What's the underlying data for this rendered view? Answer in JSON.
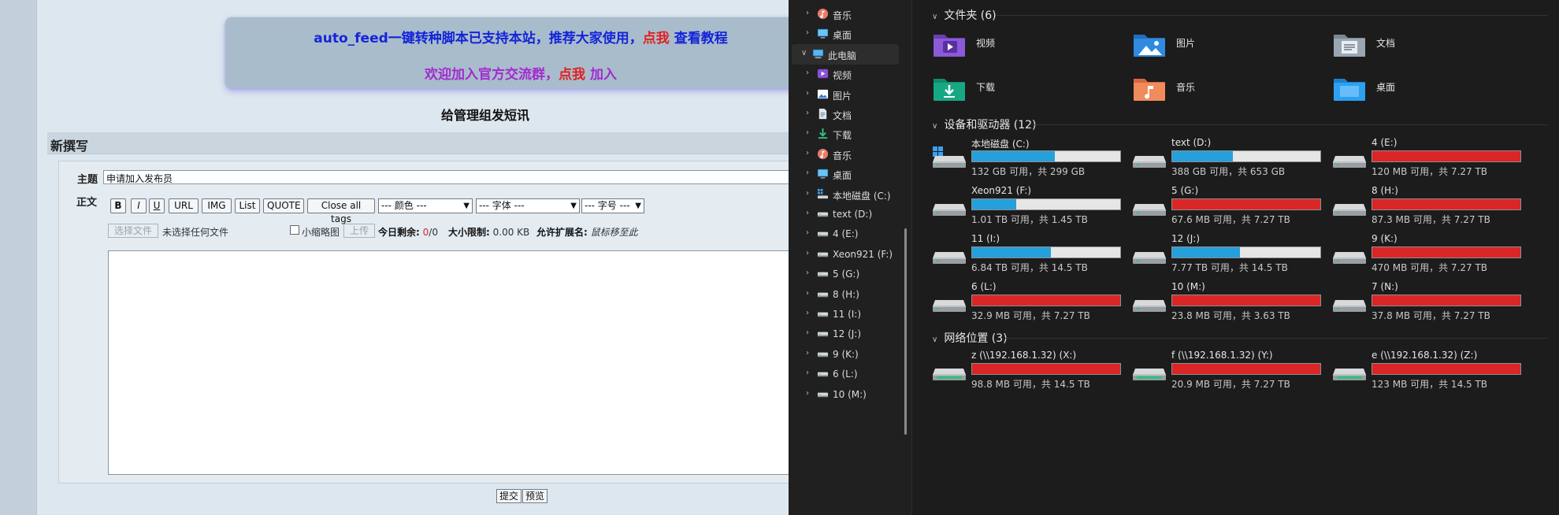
{
  "web": {
    "notice_line1_a": "auto_feed一键转种脚本已支持本站，推荐大家使用，",
    "notice_line1_red": "点我",
    "notice_line1_b": " 查看教程",
    "notice_line2_a": "欢迎加入官方交流群，",
    "notice_line2_red": "点我",
    "notice_line2_b": " 加入",
    "pm_title": "给管理组发短讯",
    "compose_title": "新撰写",
    "subject_label": "主题",
    "subject_value": "申请加入发布员",
    "body_label": "正文",
    "toolbar": [
      "B",
      "I",
      "U",
      "URL",
      "IMG",
      "List",
      "QUOTE",
      "Close all tags"
    ],
    "color_select": "--- 颜色 ---",
    "font_select": "--- 字体 ---",
    "size_select": "--- 字号 ---",
    "choose_file": "选择文件",
    "no_file": "未选择任何文件",
    "thumb_label": "小缩略图",
    "upload": "上传",
    "remaining_label": "今日剩余:",
    "remaining_used": "0",
    "remaining_total": "/0",
    "size_limit_label": "大小限制:",
    "size_limit_value": "0.00 KB",
    "ext_label": "允许扩展名:",
    "ext_value": "鼠标移至此",
    "submit": "提交",
    "preview": "预览"
  },
  "explorer": {
    "nav": [
      {
        "label": "音乐",
        "icon": "music-icon",
        "indent": 1
      },
      {
        "label": "桌面",
        "icon": "desktop-icon",
        "indent": 1
      },
      {
        "label": "此电脑",
        "icon": "computer-icon",
        "indent": 0,
        "expanded": true
      },
      {
        "label": "视频",
        "icon": "video-icon",
        "indent": 1
      },
      {
        "label": "图片",
        "icon": "pictures-icon",
        "indent": 1
      },
      {
        "label": "文档",
        "icon": "documents-icon",
        "indent": 1
      },
      {
        "label": "下载",
        "icon": "download-icon",
        "indent": 1
      },
      {
        "label": "音乐",
        "icon": "music-icon",
        "indent": 1
      },
      {
        "label": "桌面",
        "icon": "desktop-icon",
        "indent": 1
      },
      {
        "label": "本地磁盘 (C:)",
        "icon": "system-drive-icon",
        "indent": 1
      },
      {
        "label": "text (D:)",
        "icon": "drive-icon",
        "indent": 1
      },
      {
        "label": "4 (E:)",
        "icon": "drive-icon",
        "indent": 1
      },
      {
        "label": "Xeon921 (F:)",
        "icon": "drive-icon",
        "indent": 1
      },
      {
        "label": "5 (G:)",
        "icon": "drive-icon",
        "indent": 1
      },
      {
        "label": "8 (H:)",
        "icon": "drive-icon",
        "indent": 1
      },
      {
        "label": "11 (I:)",
        "icon": "drive-icon",
        "indent": 1
      },
      {
        "label": "12 (J:)",
        "icon": "drive-icon",
        "indent": 1
      },
      {
        "label": "9 (K:)",
        "icon": "drive-icon",
        "indent": 1
      },
      {
        "label": "6 (L:)",
        "icon": "drive-icon",
        "indent": 1
      },
      {
        "label": "10 (M:)",
        "icon": "drive-icon",
        "indent": 1
      }
    ],
    "folders_header": "文件夹 (6)",
    "folders": [
      {
        "label": "视频",
        "icon": "video-folder-icon"
      },
      {
        "label": "图片",
        "icon": "pictures-folder-icon"
      },
      {
        "label": "文档",
        "icon": "documents-folder-icon"
      },
      {
        "label": "下载",
        "icon": "downloads-folder-icon"
      },
      {
        "label": "音乐",
        "icon": "music-folder-icon"
      },
      {
        "label": "桌面",
        "icon": "desktop-folder-icon"
      }
    ],
    "drives_header": "设备和驱动器 (12)",
    "drives": [
      {
        "label": "本地磁盘 (C:)",
        "caption": "132 GB 可用，共 299 GB",
        "used": 0.56,
        "status": "ok",
        "system": true
      },
      {
        "label": "text (D:)",
        "caption": "388 GB 可用，共 653 GB",
        "used": 0.41,
        "status": "ok"
      },
      {
        "label": "4 (E:)",
        "caption": "120 MB 可用，共 7.27 TB",
        "used": 1.0,
        "status": "full"
      },
      {
        "label": "Xeon921 (F:)",
        "caption": "1.01 TB 可用，共 1.45 TB",
        "used": 0.3,
        "status": "ok"
      },
      {
        "label": "5 (G:)",
        "caption": "67.6 MB 可用，共 7.27 TB",
        "used": 1.0,
        "status": "full"
      },
      {
        "label": "8 (H:)",
        "caption": "87.3 MB 可用，共 7.27 TB",
        "used": 1.0,
        "status": "full"
      },
      {
        "label": "11 (I:)",
        "caption": "6.84 TB 可用，共 14.5 TB",
        "used": 0.53,
        "status": "ok"
      },
      {
        "label": "12 (J:)",
        "caption": "7.77 TB 可用，共 14.5 TB",
        "used": 0.46,
        "status": "ok"
      },
      {
        "label": "9 (K:)",
        "caption": "470 MB 可用，共 7.27 TB",
        "used": 1.0,
        "status": "full"
      },
      {
        "label": "6 (L:)",
        "caption": "32.9 MB 可用，共 7.27 TB",
        "used": 1.0,
        "status": "full"
      },
      {
        "label": "10 (M:)",
        "caption": "23.8 MB 可用，共 3.63 TB",
        "used": 1.0,
        "status": "full"
      },
      {
        "label": "7 (N:)",
        "caption": "37.8 MB 可用，共 7.27 TB",
        "used": 1.0,
        "status": "full"
      }
    ],
    "network_header": "网络位置 (3)",
    "network": [
      {
        "label": "z (\\\\192.168.1.32) (X:)",
        "caption": "98.8 MB 可用，共 14.5 TB",
        "used": 1.0,
        "status": "full"
      },
      {
        "label": "f (\\\\192.168.1.32) (Y:)",
        "caption": "20.9 MB 可用，共 7.27 TB",
        "used": 1.0,
        "status": "full"
      },
      {
        "label": "e (\\\\192.168.1.32) (Z:)",
        "caption": "123 MB 可用，共 14.5 TB",
        "used": 1.0,
        "status": "full"
      }
    ],
    "colors": {
      "bar_ok": "#26a0da",
      "bar_full": "#da2626",
      "bar_bg": "#e6e6e6"
    }
  }
}
